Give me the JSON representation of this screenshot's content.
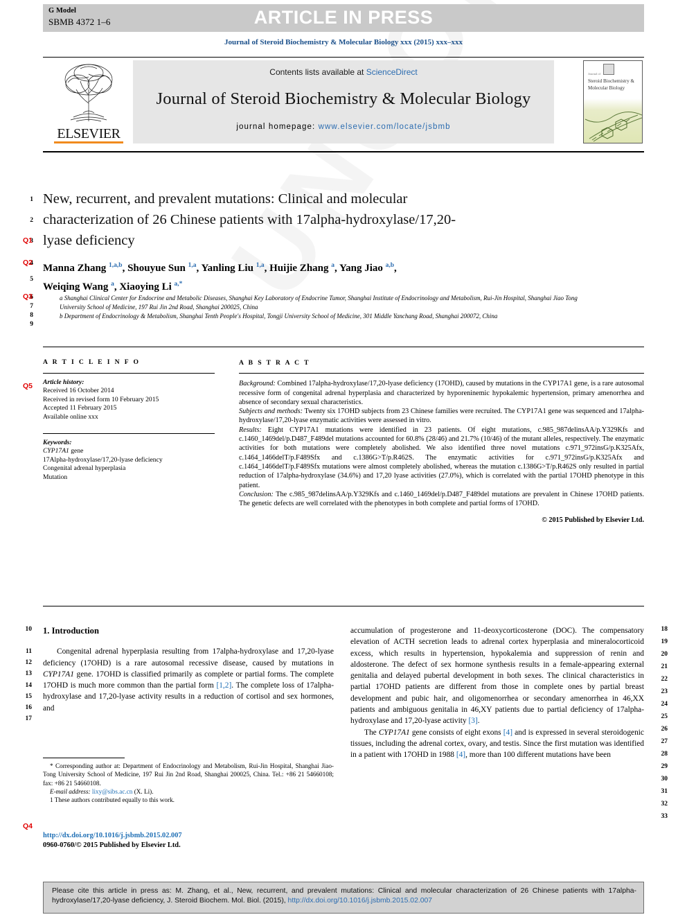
{
  "header": {
    "g_model_label": "G Model",
    "g_model_id": "SBMB 4372 1–6",
    "article_in_press": "ARTICLE IN PRESS",
    "journal_ref": "Journal of Steroid Biochemistry & Molecular Biology xxx (2015) xxx–xxx"
  },
  "masthead": {
    "contents_prefix": "Contents lists available at ",
    "contents_link": "ScienceDirect",
    "journal_name": "Journal of Steroid Biochemistry & Molecular Biology",
    "homepage_prefix": "journal homepage: ",
    "homepage_url": "www.elsevier.com/locate/jsbmb",
    "publisher": "ELSEVIER",
    "cover_title": "Steroid Biochemistry & Molecular Biology",
    "accent_orange": "#f08a1d",
    "link_blue": "#2b6cb0"
  },
  "article": {
    "title_line1": "New, recurrent, and prevalent mutations: Clinical and molecular",
    "title_line2": "characterization of 26 Chinese patients with 17alpha-hydroxylase/17,20-",
    "title_line3": "lyase deficiency",
    "authors_line1": "Manna Zhang 1,a,b, Shouyue Sun 1,a, Yanling Liu 1,a, Huijie Zhang a, Yang Jiao a,b,",
    "authors_line2": "Weiqing Wang a, Xiaoying Li a,*",
    "affiliation_a": "a Shanghai Clinical Center for Endocrine and Metabolic Diseases, Shanghai Key Laboratory of Endocrine Tumor, Shanghai Institute of Endocrinology and Metabolism, Rui-Jin Hospital, Shanghai Jiao Tong University School of Medicine, 197 Rui Jin 2nd Road, Shanghai 200025, China",
    "affiliation_b": "b Department of Endocrinology & Metabolism, Shanghai Tenth People's Hospital, Tongji University School of Medicine, 301 Middle Yanchang Road, Shanghai 200072, China"
  },
  "info": {
    "heading": "A R T I C L E  I N F O",
    "history_label": "Article history:",
    "history": [
      "Received 16 October 2014",
      "Received in revised form 10 February 2015",
      "Accepted 11 February 2015",
      "Available online xxx"
    ],
    "keywords_label": "Keywords:",
    "keywords": [
      "CYP17A1 gene",
      "17Alpha-hydroxylase/17,20-lyase deficiency",
      "Congenital adrenal hyperplasia",
      "Mutation"
    ]
  },
  "abstract": {
    "heading": "A B S T R A C T",
    "background_label": "Background:",
    "background_text": " Combined 17alpha-hydroxylase/17,20-lyase deficiency (17OHD), caused by mutations in the CYP17A1 gene, is a rare autosomal recessive form of congenital adrenal hyperplasia and characterized by hyporeninemic hypokalemic hypertension, primary amenorrhea and absence of secondary sexual characteristics.",
    "methods_label": "Subjects and methods:",
    "methods_text": " Twenty six 17OHD subjects from 23 Chinese families were recruited. The CYP17A1 gene was sequenced and 17alpha-hydroxylase/17,20-lyase enzymatic activities were assessed in vitro.",
    "results_label": "Results:",
    "results_text": " Eight CYP17A1 mutations were identified in 23 patients. Of eight mutations, c.985_987delinsAA/p.Y329Kfs and c.1460_1469del/p.D487_F489del mutations accounted for 60.8% (28/46) and 21.7% (10/46) of the mutant alleles, respectively. The enzymatic activities for both mutations were completely abolished. We also identified three novel mutations c.971_972insG/p.K325Afx, c.1464_1466delT/p.F489Sfx and c.1386G>T/p.R462S. The enzymatic activities for c.971_972insG/p.K325Afx and c.1464_1466delT/p.F489Sfx mutations were almost completely abolished, whereas the mutation c.1386G>T/p.R462S only resulted in partial reduction of 17alpha-hydroxylase (34.6%) and 17,20 lyase activities (27.0%), which is correlated with the partial 17OHD phenotype in this patient.",
    "conclusion_label": "Conclusion:",
    "conclusion_text": " The c.985_987delinsAA/p.Y329Kfs and c.1460_1469del/p.D487_F489del mutations are prevalent in Chinese 17OHD patients. The genetic defects are well correlated with the phenotypes in both complete and partial forms of 17OHD.",
    "copyright": "© 2015 Published by Elsevier Ltd."
  },
  "body": {
    "section_heading": "1. Introduction",
    "left_para": "Congenital adrenal hyperplasia resulting from 17alpha-hydroxylase and 17,20-lyase deficiency (17OHD) is a rare autosomal recessive disease, caused by mutations in CYP17A1 gene. 17OHD is classified primarily as complete or partial forms. The complete 17OHD is much more common than the partial form [1,2]. The complete loss of 17alpha-hydroxylase and 17,20-lyase activity results in a reduction of cortisol and sex hormones, and",
    "right_para1": "accumulation of progesterone and 11-deoxycorticosterone (DOC). The compensatory elevation of ACTH secretion leads to adrenal cortex hyperplasia and mineralocorticoid excess, which results in hypertension, hypokalemia and suppression of renin and aldosterone. The defect of sex hormone synthesis results in a female-appearing external genitalia and delayed pubertal development in both sexes. The clinical characteristics in partial 17OHD patients are different from those in complete ones by partial breast development and pubic hair, and oligomenorrhea or secondary amenorrhea in 46,XX patients and ambiguous genitalia in 46,XY patients due to partial deficiency of 17alpha-hydroxylase and 17,20-lyase activity [3].",
    "right_para2": "The CYP17A1 gene consists of eight exons [4] and is expressed in several steroidogenic tissues, including the adrenal cortex, ovary, and testis. Since the first mutation was identified in a patient with 17OHD in 1988 [4], more than 100 different mutations have been"
  },
  "footnotes": {
    "corresponding": "* Corresponding author at: Department of Endocrinology and Metabolism, Rui-Jin Hospital, Shanghai Jiao-Tong University School of Medicine, 197 Rui Jin 2nd Road, Shanghai 200025, China. Tel.: +86 21 54660108; fax: +86 21 54660108.",
    "email_label": "E-mail address:",
    "email": "lixy@sibs.ac.cn",
    "email_suffix": " (X. Li).",
    "equal_contrib": "1 These authors contributed equally to this work.",
    "doi": "http://dx.doi.org/10.1016/j.jsbmb.2015.02.007",
    "issn_line": "0960-0760/© 2015 Published by Elsevier Ltd."
  },
  "citation": {
    "text_part1": "Please cite this article in press as: M. Zhang, et al., New, recurrent, and prevalent mutations: Clinical and molecular characterization of 26 Chinese patients with 17alpha-hydroxylase/17,20-lyase deficiency, J. Steroid Biochem. Mol. Biol. (2015), ",
    "link": "http://dx.doi.org/10.1016/j.jsbmb.2015.02.007"
  },
  "margins": {
    "left_numbers_top": [
      "1",
      "2",
      "3",
      "4",
      "5",
      "6",
      "7",
      "8",
      "9"
    ],
    "left_numbers_body": [
      "10",
      "11",
      "12",
      "13",
      "14",
      "15",
      "16",
      "17"
    ],
    "right_numbers": [
      "18",
      "19",
      "20",
      "21",
      "22",
      "23",
      "24",
      "25",
      "26",
      "27",
      "28",
      "29",
      "30",
      "31",
      "32",
      "33"
    ],
    "queries": [
      "Q1",
      "Q2",
      "Q3",
      "Q5",
      "Q4"
    ],
    "query_color": "#e00000"
  },
  "watermark": "UNCORRECTED PROOF"
}
